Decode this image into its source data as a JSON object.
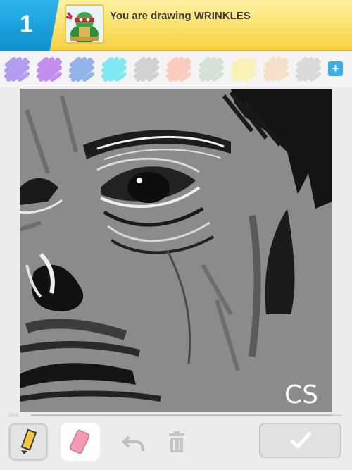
{
  "header": {
    "round_number": "1",
    "prompt_prefix": "You are drawing ",
    "word": "WRINKLES",
    "avatar_icon": "turtle-avatar-icon"
  },
  "palette": {
    "colors": [
      "#b39cf0",
      "#c58cf0",
      "#8fb3ea",
      "#7ee9f2",
      "#cfd1d3",
      "#f9ccbb",
      "#d6e1d6",
      "#f9f1b5",
      "#f5e0c8",
      "#d9d9d9"
    ],
    "add_icon": "plus-icon"
  },
  "canvas": {
    "background": "#8b8b8d",
    "signature": "CS"
  },
  "ink": {
    "label": "INK",
    "level": 0.97
  },
  "toolbar": {
    "pencil_icon": "pencil-icon",
    "eraser_icon": "eraser-icon",
    "undo_icon": "undo-icon",
    "trash_icon": "trash-icon",
    "done_icon": "checkmark-icon"
  }
}
